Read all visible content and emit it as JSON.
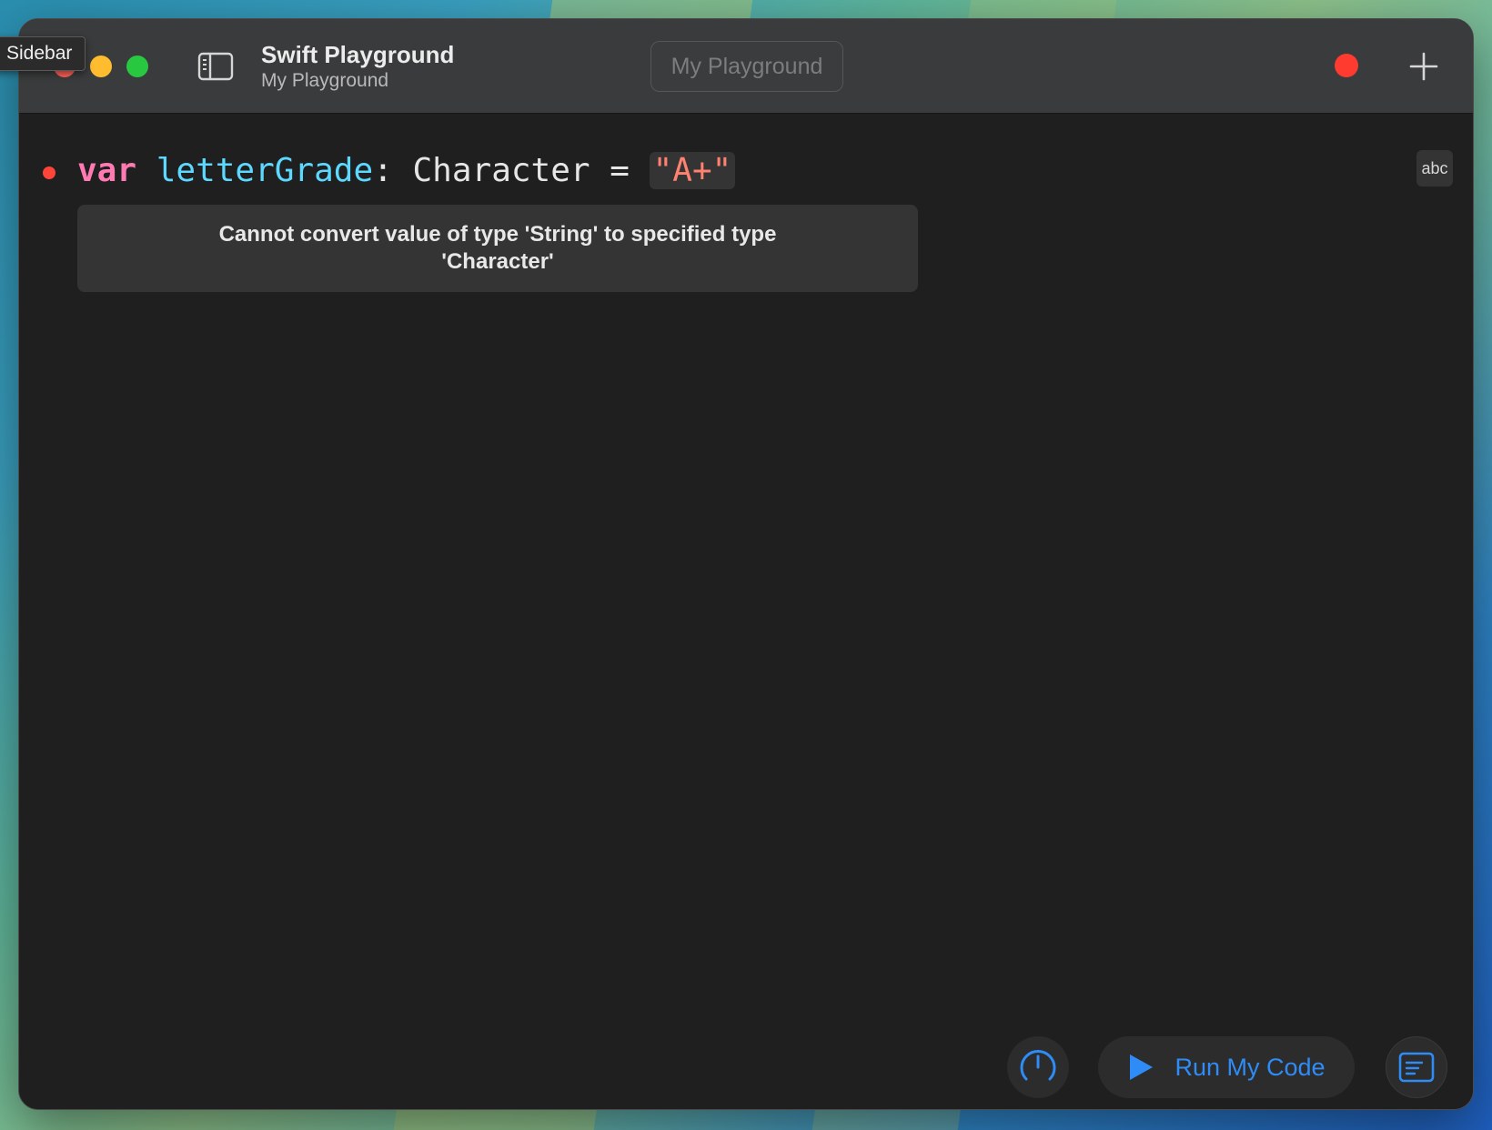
{
  "window": {
    "title": "Swift Playground",
    "subtitle": "My Playground",
    "name_field_placeholder": "My Playground"
  },
  "tooltip": {
    "text": "Sidebar"
  },
  "editor": {
    "code": {
      "keyword": "var",
      "identifier": "letterGrade",
      "colon": ": ",
      "type": "Character",
      "assign": " = ",
      "string_literal": "\"A+\""
    },
    "error_message": "Cannot convert value of type 'String' to specified type 'Character'",
    "result_badge": "abc"
  },
  "toolbar": {
    "run_label": "Run My Code"
  },
  "icons": {
    "sidebar": "sidebar-icon",
    "add": "plus-icon",
    "record": "record-icon",
    "gauge": "speed-gauge-icon",
    "play": "play-icon",
    "console": "console-icon"
  },
  "colors": {
    "accent": "#2f8cf6",
    "error": "#ff453a",
    "keyword": "#ff7ab2",
    "identifier": "#5dd8ff",
    "string": "#ff8170"
  }
}
